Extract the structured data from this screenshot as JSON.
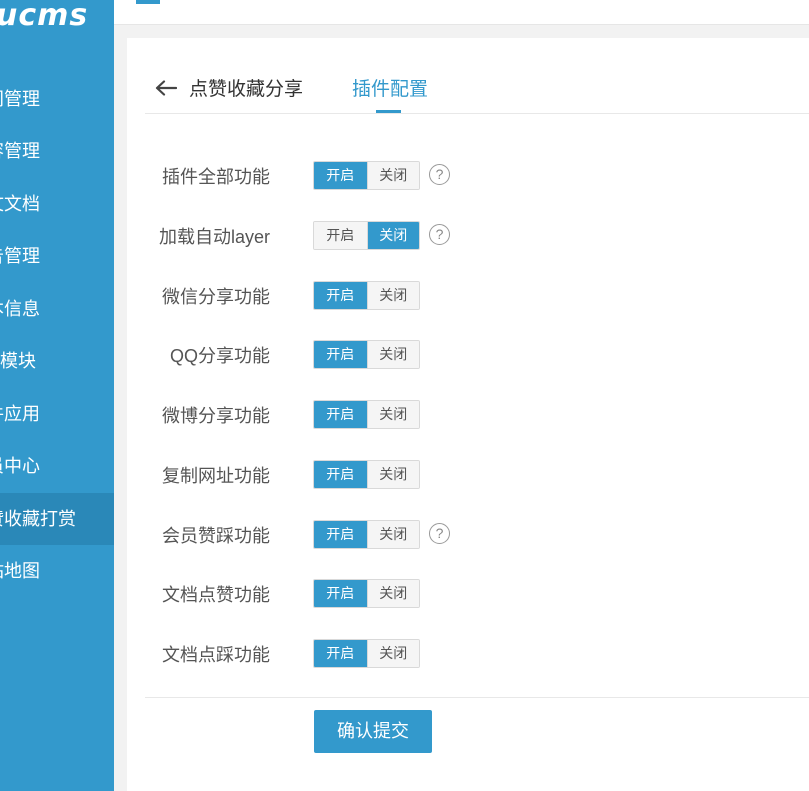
{
  "brand": {
    "logo": "ucms"
  },
  "sidebar": {
    "items": [
      {
        "label": "内容管理",
        "visible_text": "间管理",
        "active": false
      },
      {
        "label": "内容管理",
        "visible_text": "容管理",
        "active": false
      },
      {
        "label": "文档",
        "visible_text": "文文档",
        "active": false
      },
      {
        "label": "广告管理",
        "visible_text": "告管理",
        "active": false
      },
      {
        "label": "信息",
        "visible_text": "本信息",
        "active": false
      },
      {
        "label": "模块",
        "visible_text": "O模块",
        "active": false
      },
      {
        "label": "应用",
        "visible_text": "件应用",
        "active": false
      },
      {
        "label": "中心",
        "visible_text": "员中心",
        "active": false
      },
      {
        "label": "点赞收藏打赏",
        "visible_text": "赞收藏打赏",
        "active": true
      },
      {
        "label": "地图",
        "visible_text": "站地图",
        "active": false
      }
    ]
  },
  "header": {
    "back_icon": "arrow-left-icon",
    "title": "点赞收藏分享",
    "tab": "插件配置"
  },
  "form": {
    "on_label": "开启",
    "off_label": "关闭",
    "help_glyph": "?",
    "rows": [
      {
        "label": "插件全部功能",
        "value": "on",
        "help": true
      },
      {
        "label": "加载自动layer",
        "value": "off",
        "help": true
      },
      {
        "label": "微信分享功能",
        "value": "on",
        "help": false
      },
      {
        "label": "QQ分享功能",
        "value": "on",
        "help": false
      },
      {
        "label": "微博分享功能",
        "value": "on",
        "help": false
      },
      {
        "label": "复制网址功能",
        "value": "on",
        "help": false
      },
      {
        "label": "会员赞踩功能",
        "value": "on",
        "help": true
      },
      {
        "label": "文档点赞功能",
        "value": "on",
        "help": false
      },
      {
        "label": "文档点踩功能",
        "value": "on",
        "help": false
      }
    ],
    "submit_label": "确认提交"
  },
  "colors": {
    "accent": "#3399cc",
    "sidebar_active": "#2a88b8"
  }
}
